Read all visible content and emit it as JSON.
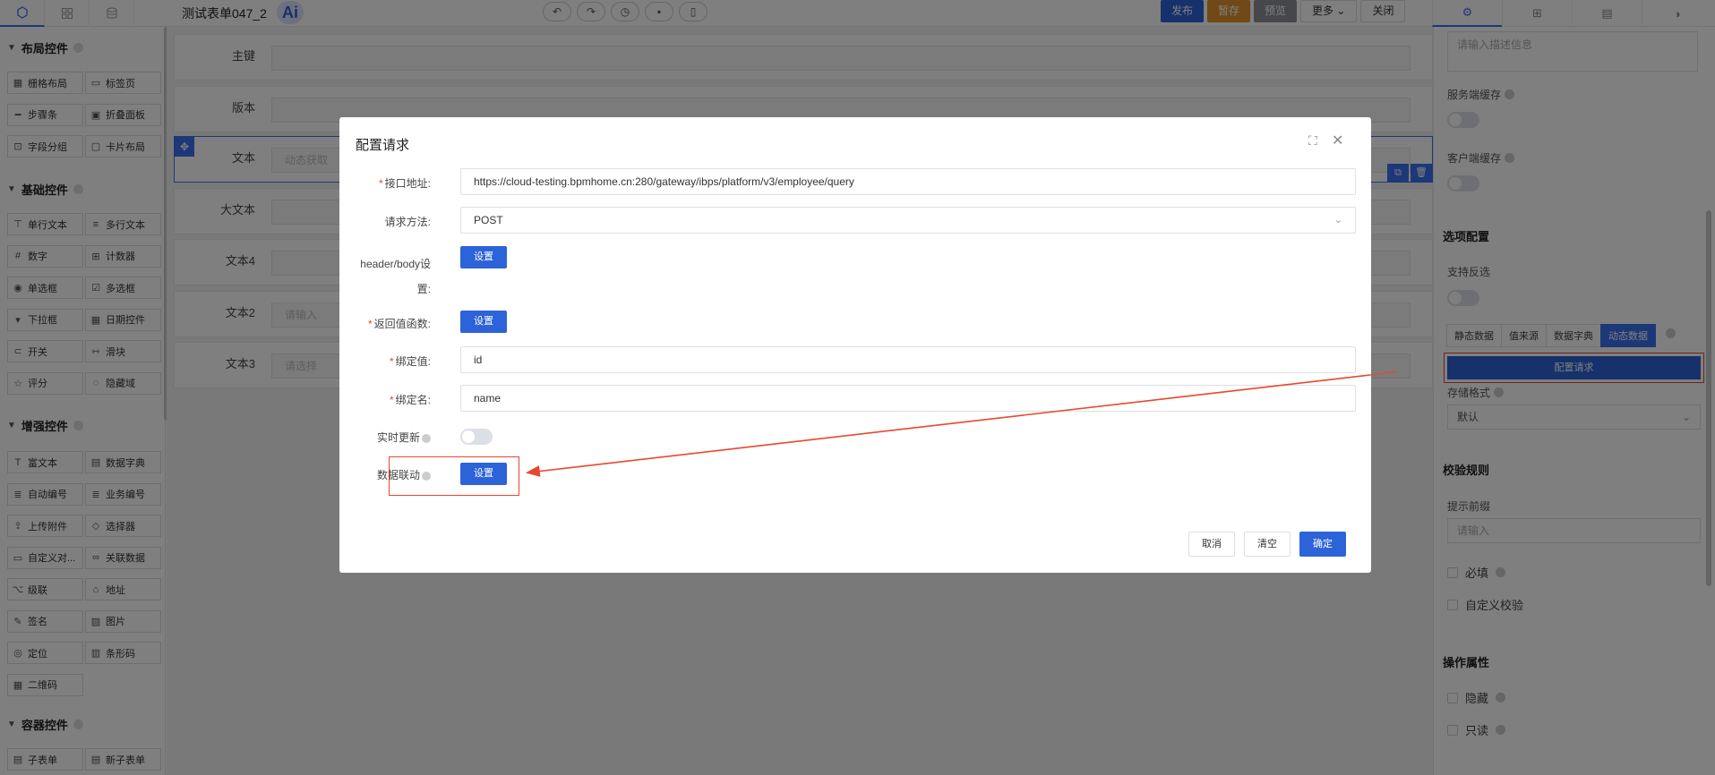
{
  "topbar": {
    "left_tabs": [
      "component-tab-icon",
      "layout-tab-icon",
      "data-tab-icon"
    ],
    "form_title": "测试表单047_2",
    "ai_label": "Ai",
    "actions": {
      "publish": "发布",
      "draft": "暂存",
      "preview": "预览",
      "more": "更多",
      "close": "关闭"
    },
    "right_tabs": [
      "gear-icon",
      "grid-icon",
      "layout-icon",
      "palette-icon"
    ]
  },
  "sidebar": {
    "sections": [
      {
        "title": "布局控件",
        "items": [
          {
            "label": "栅格布局",
            "icon": "grid-icon"
          },
          {
            "label": "标签页",
            "icon": "tab-icon"
          },
          {
            "label": "步骤条",
            "icon": "steps-icon"
          },
          {
            "label": "折叠面板",
            "icon": "collapse-icon"
          },
          {
            "label": "字段分组",
            "icon": "group-icon"
          },
          {
            "label": "卡片布局",
            "icon": "card-icon"
          }
        ]
      },
      {
        "title": "基础控件",
        "items": [
          {
            "label": "单行文本",
            "icon": "text-icon"
          },
          {
            "label": "多行文本",
            "icon": "textarea-icon"
          },
          {
            "label": "数字",
            "icon": "number-icon"
          },
          {
            "label": "计数器",
            "icon": "counter-icon"
          },
          {
            "label": "单选框",
            "icon": "radio-icon"
          },
          {
            "label": "多选框",
            "icon": "checkbox-icon"
          },
          {
            "label": "下拉框",
            "icon": "select-icon"
          },
          {
            "label": "日期控件",
            "icon": "calendar-icon"
          },
          {
            "label": "开关",
            "icon": "switch-icon"
          },
          {
            "label": "滑块",
            "icon": "slider-icon"
          },
          {
            "label": "评分",
            "icon": "star-icon"
          },
          {
            "label": "隐藏域",
            "icon": "hidden-icon"
          }
        ]
      },
      {
        "title": "增强控件",
        "items": [
          {
            "label": "富文本",
            "icon": "richtext-icon"
          },
          {
            "label": "数据字典",
            "icon": "dictionary-icon"
          },
          {
            "label": "自动编号",
            "icon": "autonumber-icon"
          },
          {
            "label": "业务编号",
            "icon": "bizcode-icon"
          },
          {
            "label": "上传附件",
            "icon": "upload-icon"
          },
          {
            "label": "选择器",
            "icon": "selector-icon"
          },
          {
            "label": "自定义对...",
            "icon": "dialog-icon"
          },
          {
            "label": "关联数据",
            "icon": "link-icon"
          },
          {
            "label": "级联",
            "icon": "cascade-icon"
          },
          {
            "label": "地址",
            "icon": "address-icon"
          },
          {
            "label": "签名",
            "icon": "signature-icon"
          },
          {
            "label": "图片",
            "icon": "image-icon"
          },
          {
            "label": "定位",
            "icon": "location-icon"
          },
          {
            "label": "条形码",
            "icon": "barcode-icon"
          },
          {
            "label": "二维码",
            "icon": "qrcode-icon"
          }
        ]
      },
      {
        "title": "容器控件",
        "items": [
          {
            "label": "子表单",
            "icon": "subform-icon"
          },
          {
            "label": "新子表单",
            "icon": "new-subform-icon"
          }
        ]
      }
    ]
  },
  "canvas": {
    "rows": [
      {
        "label": "主键",
        "placeholder": ""
      },
      {
        "label": "版本",
        "placeholder": ""
      },
      {
        "label": "文本",
        "placeholder": "动态获取"
      },
      {
        "label": "大文本",
        "placeholder": ""
      },
      {
        "label": "文本4",
        "placeholder": ""
      },
      {
        "label": "文本2",
        "placeholder": "请输入"
      },
      {
        "label": "文本3",
        "placeholder": "请选择"
      }
    ]
  },
  "right_panel": {
    "desc_placeholder": "请输入描述信息",
    "service_cache": "服务端缓存",
    "client_cache": "客户端缓存",
    "options_title": "选项配置",
    "support_reverse": "支持反选",
    "source_tabs": [
      "静态数据",
      "值来源",
      "数据字典",
      "动态数据"
    ],
    "config_request": "配置请求",
    "storage_format": "存储格式",
    "storage_value": "默认",
    "validation_title": "校验规则",
    "hint_label": "提示前缀",
    "hint_placeholder": "请输入",
    "required": "必填",
    "custom_validation": "自定义校验",
    "ops_title": "操作属性",
    "hidden": "隐藏",
    "readonly": "只读"
  },
  "modal": {
    "title": "配置请求",
    "url_label": "接口地址:",
    "url_value": "https://cloud-testing.bpmhome.cn:280/gateway/ibps/platform/v3/employee/query",
    "method_label": "请求方法:",
    "method_value": "POST",
    "header_label_1": "header/body设",
    "header_label_2": "置:",
    "set_label": "设置",
    "return_label": "返回值函数:",
    "bind_value_label": "绑定值:",
    "bind_value": "id",
    "bind_name_label": "绑定名:",
    "bind_name": "name",
    "realtime_label": "实时更新",
    "linkage_label": "数据联动",
    "cancel": "取消",
    "clear": "清空",
    "confirm": "确定"
  }
}
